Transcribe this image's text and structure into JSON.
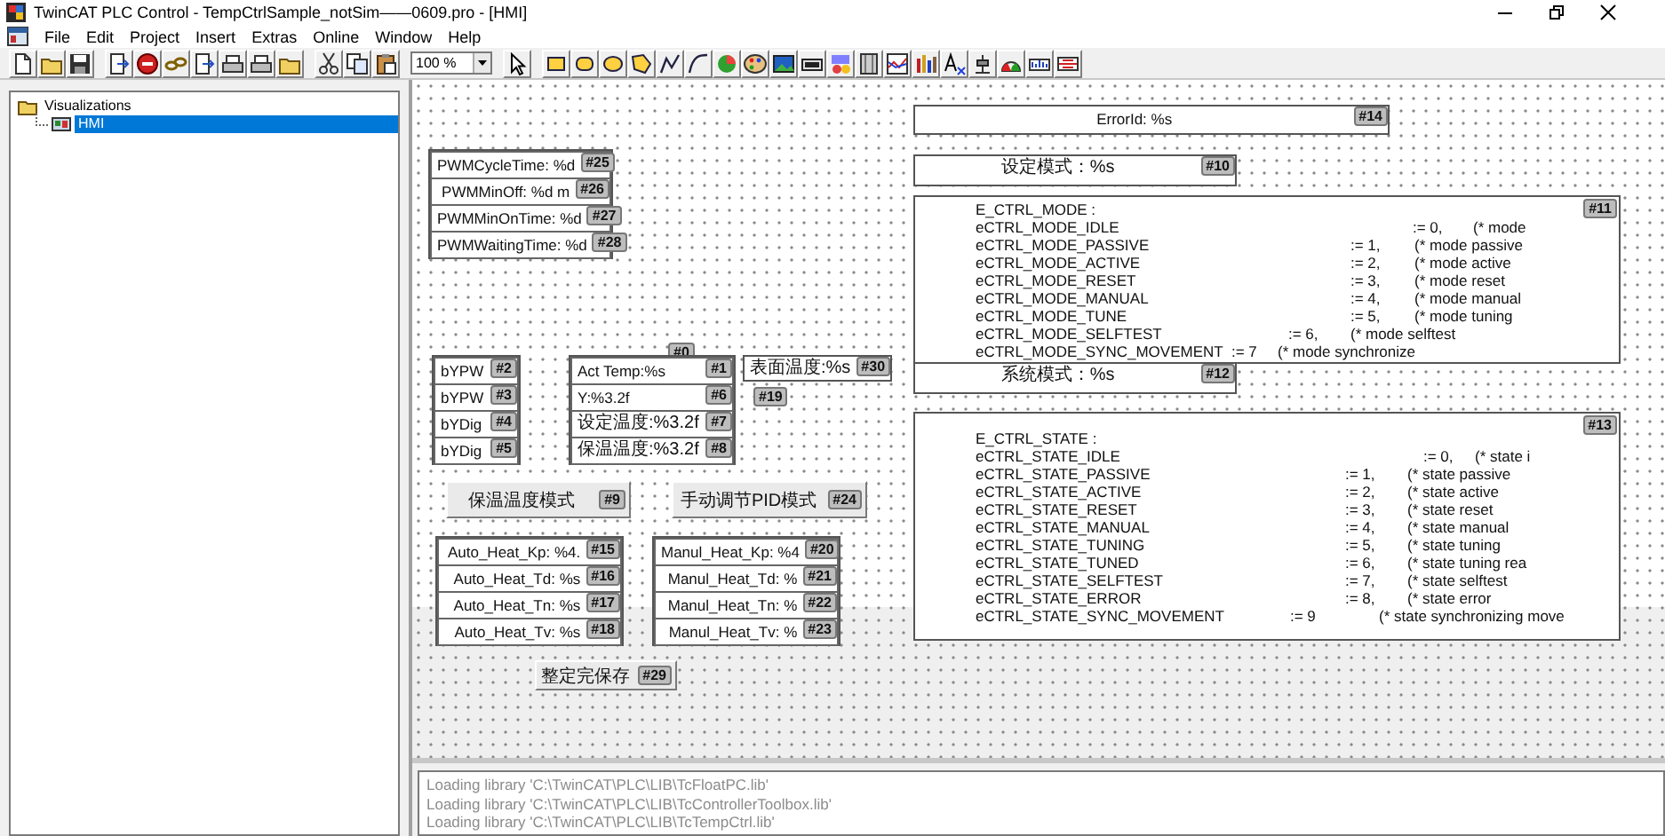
{
  "window": {
    "title": "TwinCAT PLC Control - TempCtrlSample_notSim——0609.pro - [HMI]"
  },
  "menu": [
    "File",
    "Edit",
    "Project",
    "Insert",
    "Extras",
    "Online",
    "Window",
    "Help"
  ],
  "toolbar": {
    "zoom": "100 %"
  },
  "tree": [
    {
      "label": "Visualizations",
      "selected": false,
      "children": [
        {
          "label": "HMI",
          "selected": true
        }
      ]
    }
  ],
  "canvas": {
    "elements": [
      {
        "kind": "stack",
        "rows": [
          {
            "text": "PWMCycleTime: %d",
            "tag": "#25"
          },
          {
            "text": "PWMMinOff: %d m",
            "tag": "#26"
          },
          {
            "text": "PWMMinOnTime: %d",
            "tag": "#27"
          },
          {
            "text": "PWMWaitingTime: %d",
            "tag": "#28"
          }
        ]
      },
      {
        "kind": "stack",
        "rows": [
          {
            "text": "bYPW",
            "tag": "#2"
          },
          {
            "text": "bYPW",
            "tag": "#3"
          },
          {
            "text": "bYDig",
            "tag": "#4"
          },
          {
            "text": "bYDig",
            "tag": "#5"
          }
        ]
      },
      {
        "kind": "tag",
        "tag": "#0"
      },
      {
        "kind": "stack",
        "rows": [
          {
            "text": "Act Temp:%s",
            "tag": "#1"
          },
          {
            "text": "Y:%3.2f",
            "tag": "#6"
          },
          {
            "text": "设定温度:%3.2f",
            "tag": "#7"
          },
          {
            "text": "保温温度:%3.2f",
            "tag": "#8"
          }
        ]
      },
      {
        "kind": "field",
        "text": "表面温度:%s",
        "tag": "#30"
      },
      {
        "kind": "tag",
        "tag": "#19"
      },
      {
        "kind": "button",
        "text": "保温温度模式",
        "tag": "#9"
      },
      {
        "kind": "button",
        "text": "手动调节PID模式",
        "tag": "#24"
      },
      {
        "kind": "stack",
        "rows": [
          {
            "text": "Auto_Heat_Kp: %4.",
            "tag": "#15"
          },
          {
            "text": "Auto_Heat_Td: %s",
            "tag": "#16"
          },
          {
            "text": "Auto_Heat_Tn: %s",
            "tag": "#17"
          },
          {
            "text": "Auto_Heat_Tv: %s",
            "tag": "#18"
          }
        ]
      },
      {
        "kind": "stack",
        "rows": [
          {
            "text": "Manul_Heat_Kp: %4",
            "tag": "#20"
          },
          {
            "text": "Manul_Heat_Td: %",
            "tag": "#21"
          },
          {
            "text": "Manul_Heat_Tn: %",
            "tag": "#22"
          },
          {
            "text": "Manul_Heat_Tv: %",
            "tag": "#23"
          }
        ]
      },
      {
        "kind": "button",
        "text": "整定完保存",
        "tag": "#29"
      },
      {
        "kind": "field",
        "text": "ErrorId: %s",
        "tag": "#14"
      },
      {
        "kind": "field",
        "text": "设定模式：%s",
        "tag": "#10"
      },
      {
        "kind": "listing",
        "tag": "#11",
        "header": "E_CTRL_MODE :",
        "lines": [
          {
            "name": "eCTRL_MODE_IDLE",
            "value": ":= 0,",
            "comment": "(* mode"
          },
          {
            "name": "eCTRL_MODE_PASSIVE",
            "value": ":= 1,",
            "comment": "(* mode passive"
          },
          {
            "name": "eCTRL_MODE_ACTIVE",
            "value": ":= 2,",
            "comment": "(* mode active"
          },
          {
            "name": "eCTRL_MODE_RESET",
            "value": ":= 3,",
            "comment": "(* mode reset"
          },
          {
            "name": "eCTRL_MODE_MANUAL",
            "value": ":= 4,",
            "comment": "(* mode manual"
          },
          {
            "name": "eCTRL_MODE_TUNE",
            "value": ":= 5,",
            "comment": "(* mode tuning"
          },
          {
            "name": "eCTRL_MODE_SELFTEST",
            "value": ":= 6,",
            "comment": "(* mode selftest"
          },
          {
            "name": "eCTRL_MODE_SYNC_MOVEMENT",
            "value": ":= 7",
            "comment": "(* mode synchronize"
          }
        ]
      },
      {
        "kind": "field",
        "text": "系统模式：%s",
        "tag": "#12"
      },
      {
        "kind": "listing",
        "tag": "#13",
        "header": "E_CTRL_STATE :",
        "lines": [
          {
            "name": "eCTRL_STATE_IDLE",
            "value": ":= 0,",
            "comment": "(* state i"
          },
          {
            "name": "eCTRL_STATE_PASSIVE",
            "value": ":= 1,",
            "comment": "(* state passive"
          },
          {
            "name": "eCTRL_STATE_ACTIVE",
            "value": ":= 2,",
            "comment": "(* state active"
          },
          {
            "name": "eCTRL_STATE_RESET",
            "value": ":= 3,",
            "comment": "(* state reset"
          },
          {
            "name": "eCTRL_STATE_MANUAL",
            "value": ":= 4,",
            "comment": "(* state manual"
          },
          {
            "name": "eCTRL_STATE_TUNING",
            "value": ":= 5,",
            "comment": "(* state tuning"
          },
          {
            "name": "eCTRL_STATE_TUNED",
            "value": ":= 6,",
            "comment": "(* state tuning rea"
          },
          {
            "name": "eCTRL_STATE_SELFTEST",
            "value": ":= 7,",
            "comment": "(* state selftest"
          },
          {
            "name": "eCTRL_STATE_ERROR",
            "value": ":= 8,",
            "comment": "(* state error"
          },
          {
            "name": "eCTRL_STATE_SYNC_MOVEMENT",
            "value": ":= 9",
            "comment": "(* state synchronizing move"
          }
        ]
      }
    ]
  },
  "log": [
    "Loading library 'C:\\TwinCAT\\PLC\\LIB\\TcFloatPC.lib'",
    "Loading library 'C:\\TwinCAT\\PLC\\LIB\\TcControllerToolbox.lib'",
    "Loading library 'C:\\TwinCAT\\PLC\\LIB\\TcTempCtrl.lib'"
  ]
}
